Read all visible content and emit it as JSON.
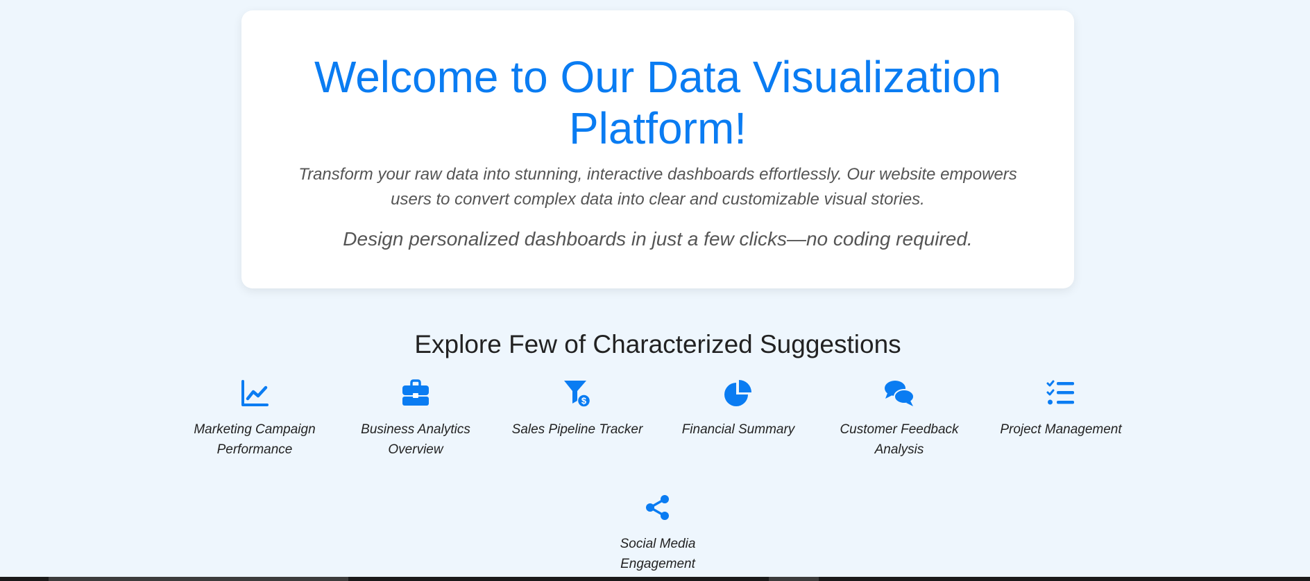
{
  "hero": {
    "title": "Welcome to Our Data Visualization Platform!",
    "lead": "Transform your raw data into stunning, interactive dashboards effortlessly. Our website empowers users to convert complex data into clear and customizable visual stories.",
    "sub": "Design personalized dashboards in just a few clicks—no coding required."
  },
  "suggestions_section": {
    "title": "Explore Few of Characterized Suggestions",
    "items": [
      {
        "label": "Marketing Campaign Performance",
        "icon": "chart-line-icon"
      },
      {
        "label": "Business Analytics Overview",
        "icon": "briefcase-icon"
      },
      {
        "label": "Sales Pipeline Tracker",
        "icon": "funnel-dollar-icon"
      },
      {
        "label": "Financial Summary",
        "icon": "pie-chart-icon"
      },
      {
        "label": "Customer Feedback Analysis",
        "icon": "comments-icon"
      },
      {
        "label": "Project Management",
        "icon": "list-check-icon"
      },
      {
        "label": "Social Media Engagement",
        "icon": "share-nodes-icon"
      }
    ]
  },
  "colors": {
    "accent": "#0a7cf2",
    "background": "#eef6fd",
    "card": "#ffffff",
    "text": "#222222",
    "muted_text": "#555555"
  }
}
